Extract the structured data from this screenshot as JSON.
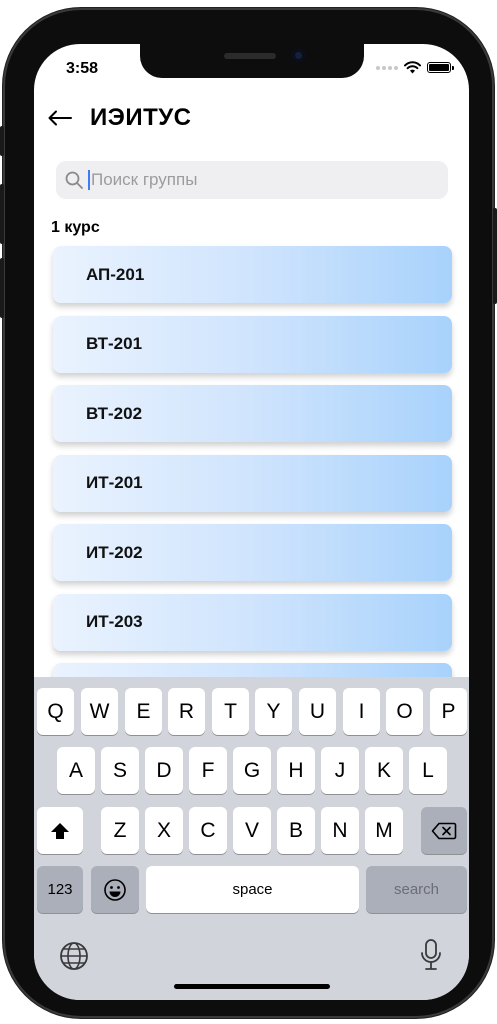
{
  "status_bar": {
    "time": "3:58"
  },
  "header": {
    "title": "ИЭИТУС"
  },
  "search": {
    "placeholder": "Поиск группы"
  },
  "section": {
    "title": "1 курс"
  },
  "groups": [
    "АП-201",
    "ВТ-201",
    "ВТ-202",
    "ИТ-201",
    "ИТ-202",
    "ИТ-203",
    ""
  ],
  "keyboard": {
    "row1": [
      "Q",
      "W",
      "E",
      "R",
      "T",
      "Y",
      "U",
      "I",
      "O",
      "P"
    ],
    "row2": [
      "A",
      "S",
      "D",
      "F",
      "G",
      "H",
      "J",
      "K",
      "L"
    ],
    "row3": [
      "Z",
      "X",
      "C",
      "V",
      "B",
      "N",
      "M"
    ],
    "numbers_label": "123",
    "space_label": "space",
    "search_label": "search"
  },
  "colors": {
    "card_start": "#eaf3fe",
    "card_end": "#a8d2fc",
    "caret": "#3d7bf7",
    "keyboard_bg": "#d1d4db"
  }
}
